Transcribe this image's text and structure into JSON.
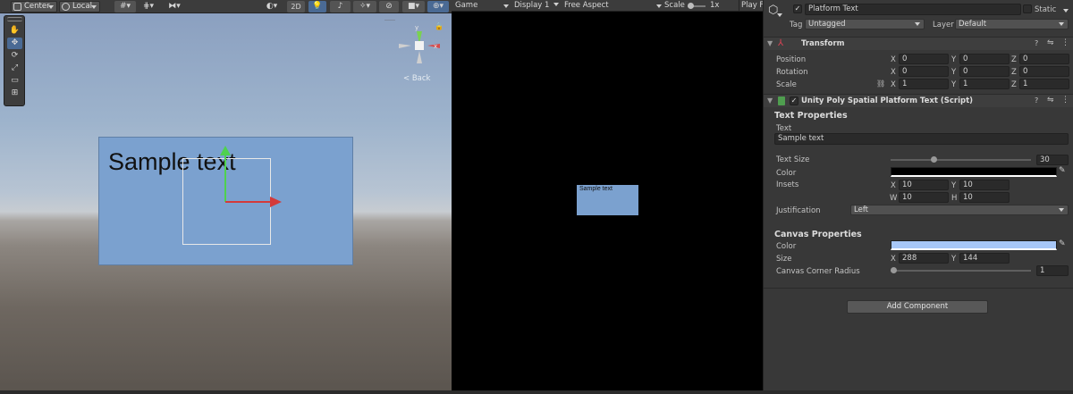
{
  "scene": {
    "toolbar": {
      "pivot_label": "Center",
      "space_label": "Local",
      "mode_2d_label": "2D"
    },
    "canvas_text": "Sample text",
    "gizmo_axis_y": "y",
    "back_label": "< Back"
  },
  "game": {
    "toolbar": {
      "tab_label": "Game",
      "display_label": "Display 1",
      "aspect_label": "Free Aspect",
      "scale_label": "Scale",
      "scale_value": "1x",
      "play_label": "Play Fo"
    },
    "canvas_text": "Sample text"
  },
  "inspector": {
    "object": {
      "name": "Platform Text",
      "active": true,
      "static_label": "Static",
      "tag_label": "Tag",
      "tag_value": "Untagged",
      "layer_label": "Layer",
      "layer_value": "Default"
    },
    "transform": {
      "title": "Transform",
      "position": {
        "label": "Position",
        "x": "0",
        "y": "0",
        "z": "0"
      },
      "rotation": {
        "label": "Rotation",
        "x": "0",
        "y": "0",
        "z": "0"
      },
      "scale": {
        "label": "Scale",
        "x": "1",
        "y": "1",
        "z": "1"
      },
      "axis_x": "X",
      "axis_y": "Y",
      "axis_z": "Z"
    },
    "script": {
      "title": "Unity Poly Spatial Platform Text (Script)",
      "enabled": true,
      "text_properties_header": "Text Properties",
      "text_label": "Text",
      "text_value": "Sample text",
      "text_size_label": "Text Size",
      "text_size_value": "30",
      "text_size_slider_fraction": 0.3,
      "color_label": "Color",
      "text_color": "#000000",
      "insets_label": "Insets",
      "insets": {
        "x": "10",
        "y": "10",
        "w": "10",
        "h": "10"
      },
      "inset_axis_w": "W",
      "inset_axis_h": "H",
      "justification_label": "Justification",
      "justification_value": "Left",
      "canvas_properties_header": "Canvas Properties",
      "canvas_color_label": "Color",
      "canvas_color": "#a7c7f7",
      "size_label": "Size",
      "size": {
        "x": "288",
        "y": "144"
      },
      "corner_radius_label": "Canvas Corner Radius",
      "corner_radius_value": "1",
      "corner_radius_slider_fraction": 0.0
    },
    "add_component_label": "Add Component"
  }
}
